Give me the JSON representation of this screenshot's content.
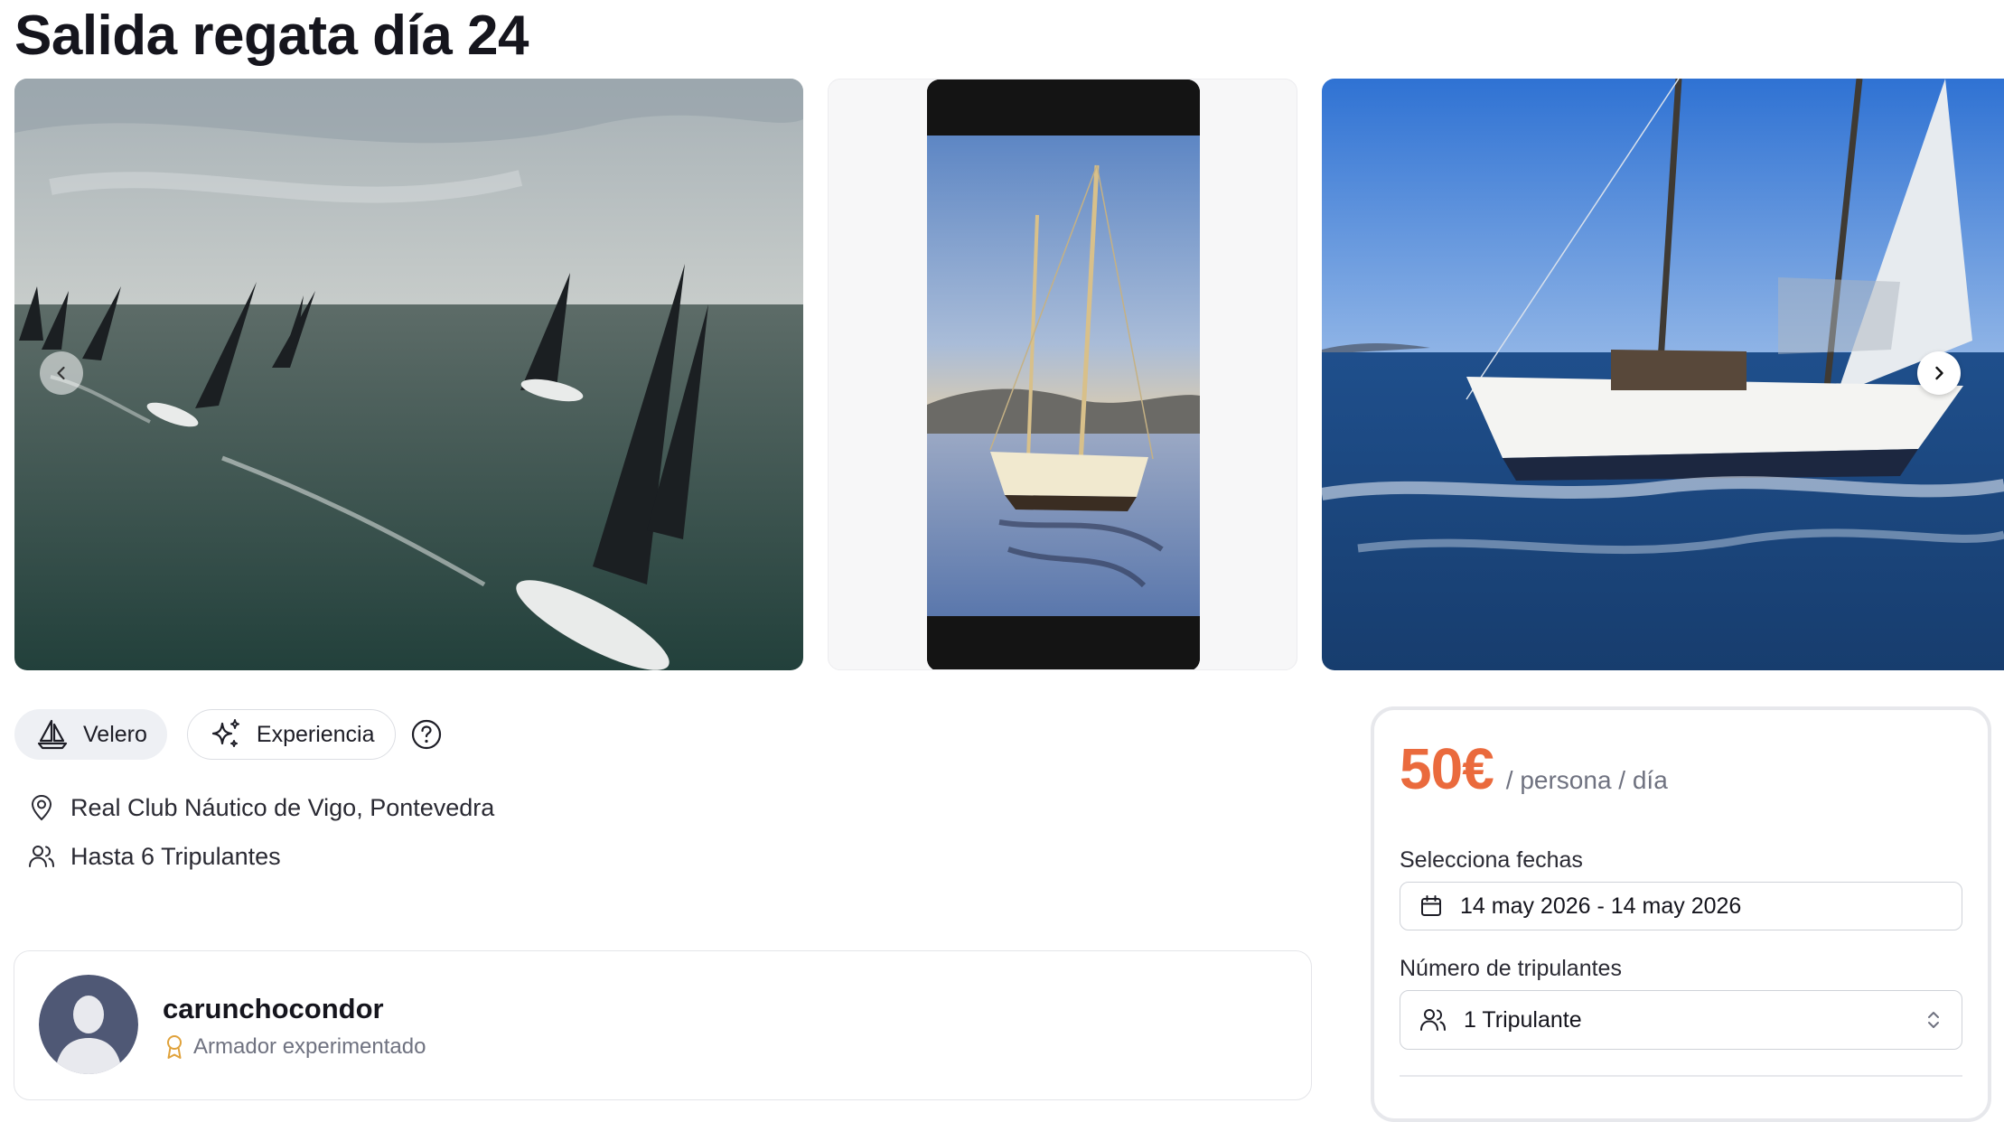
{
  "title": "Salida regata día 24",
  "gallery": {
    "images": [
      {
        "subject": "regatta-aerial-photo"
      },
      {
        "subject": "sailboat-video-thumbnail"
      },
      {
        "subject": "sailing-yacht-photo"
      }
    ],
    "prev_icon": "chevron-left-icon",
    "next_icon": "chevron-right-icon"
  },
  "tags": {
    "velero": "Velero",
    "experiencia": "Experiencia",
    "help_icon": "question-circle-icon"
  },
  "details": {
    "location": "Real Club Náutico de Vigo, Pontevedra",
    "crew": "Hasta 6 Tripulantes"
  },
  "owner": {
    "name": "carunchocondor",
    "badge": "Armador experimentado",
    "badge_color": "#e0a23b"
  },
  "booking": {
    "price": "50€",
    "per": "/ persona / día",
    "price_color": "#ea6a3d",
    "dates_label": "Selecciona fechas",
    "dates_value": "14 may 2026 - 14 may 2026",
    "crew_label": "Número de tripulantes",
    "crew_value": "1 Tripulante"
  }
}
